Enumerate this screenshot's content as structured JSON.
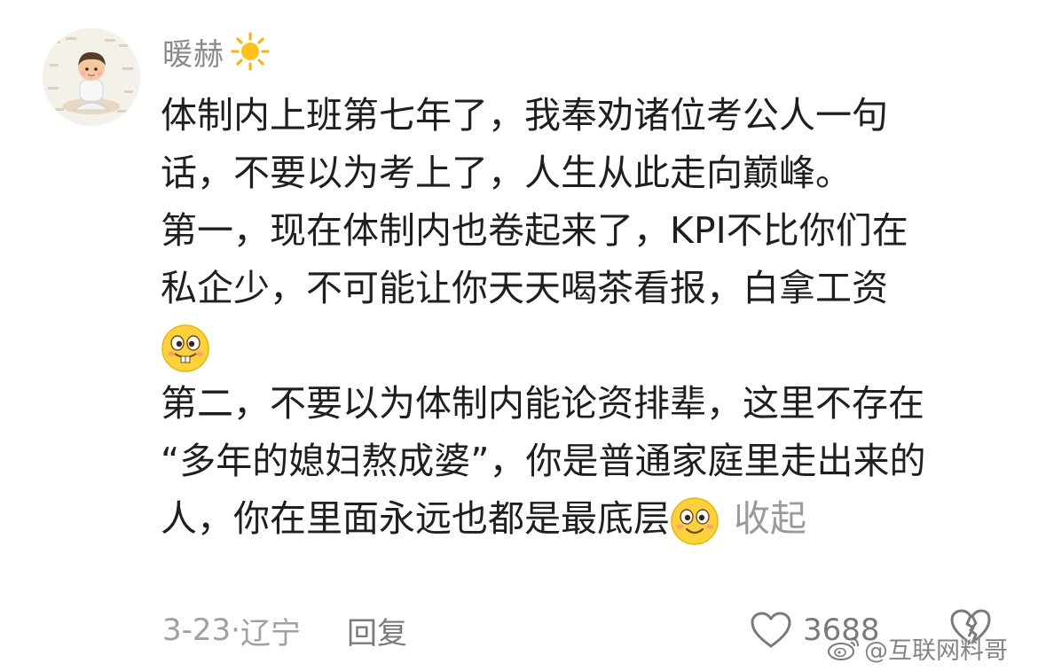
{
  "comment": {
    "username": "暖赫",
    "badge_icon": "sun-icon",
    "lines": [
      "体制内上班第七年了，我奉劝诸位考公人一句",
      "话，不要以为考上了，人生从此走向巅峰。",
      "第一，现在体制内也卷起来了，KPI不比你们在",
      "私企少，不可能让你天天喝茶看报，白拿工资",
      "第二，不要以为体制内能论资排辈，这里不存在",
      "“多年的媳妇熬成婆”，你是普通家庭里走出来的",
      "人，你在里面永远也都是最底层"
    ],
    "emoji_1": "bucktooth-grin-emoji",
    "emoji_2": "smiling-face-emoji",
    "collapse_label": "收起",
    "date": "3-23",
    "separator": "·",
    "location": "辽宁",
    "reply_label": "回复",
    "like_count": "3688"
  },
  "watermark": {
    "text": "@互联网料哥",
    "icon": "weibo-icon"
  },
  "colors": {
    "text": "#1f1f1f",
    "muted": "#a0a0a0",
    "username": "#8a8a8a",
    "emoji_face": "#ffd23a"
  }
}
